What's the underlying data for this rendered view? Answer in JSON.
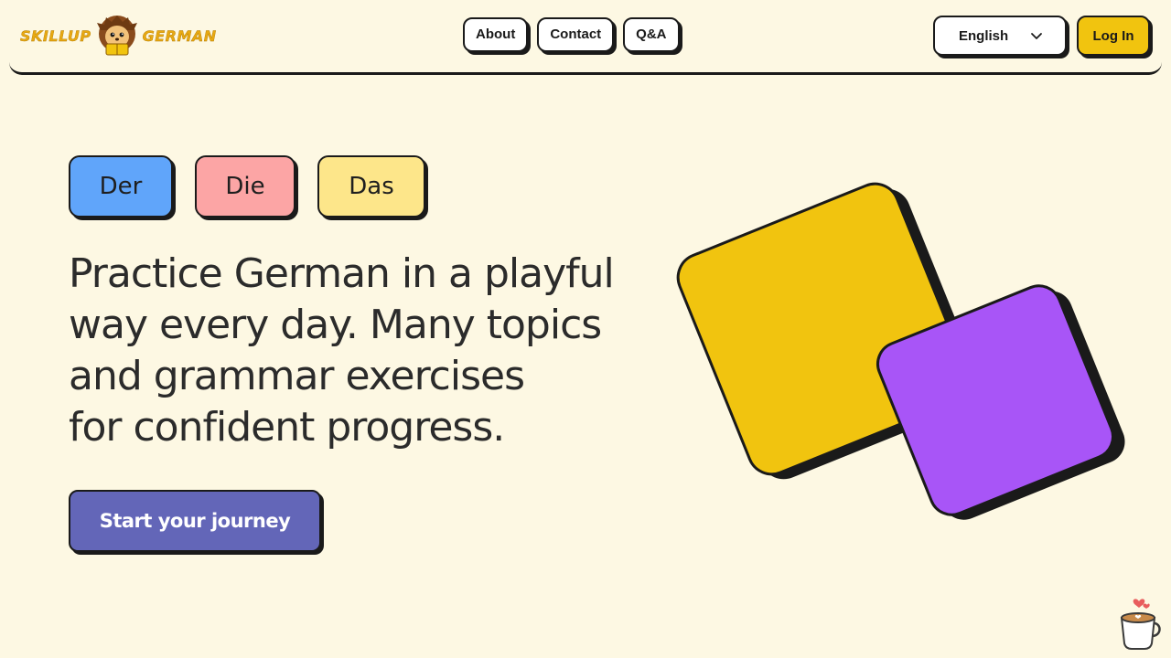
{
  "header": {
    "logo": {
      "left_text": "SKILLUP",
      "right_text": "GERMAN",
      "mascot_icon": "hedgehog-mascot-icon"
    },
    "nav": [
      {
        "label": "About"
      },
      {
        "label": "Contact"
      },
      {
        "label": "Q&A"
      }
    ],
    "language_select": {
      "value": "English",
      "icon": "chevron-down-icon"
    },
    "login_label": "Log In"
  },
  "hero": {
    "articles": [
      {
        "label": "Der",
        "color": "#60a5fa"
      },
      {
        "label": "Die",
        "color": "#fca5a5"
      },
      {
        "label": "Das",
        "color": "#fde68a"
      }
    ],
    "headline_lines": [
      "Practice German in a playful",
      "way every day. Many topics",
      "and grammar exercises",
      "for confident progress."
    ],
    "cta_label": "Start your journey"
  },
  "decor": {
    "yellow_card_color": "#f1c40f",
    "purple_card_color": "#a855f7"
  },
  "support_widget": {
    "icon": "coffee-cup-icon"
  },
  "colors": {
    "background": "#fdf8e3",
    "accent_yellow": "#f1c40f",
    "cta_purple": "#6366b8",
    "outline": "#1a1a1a"
  }
}
